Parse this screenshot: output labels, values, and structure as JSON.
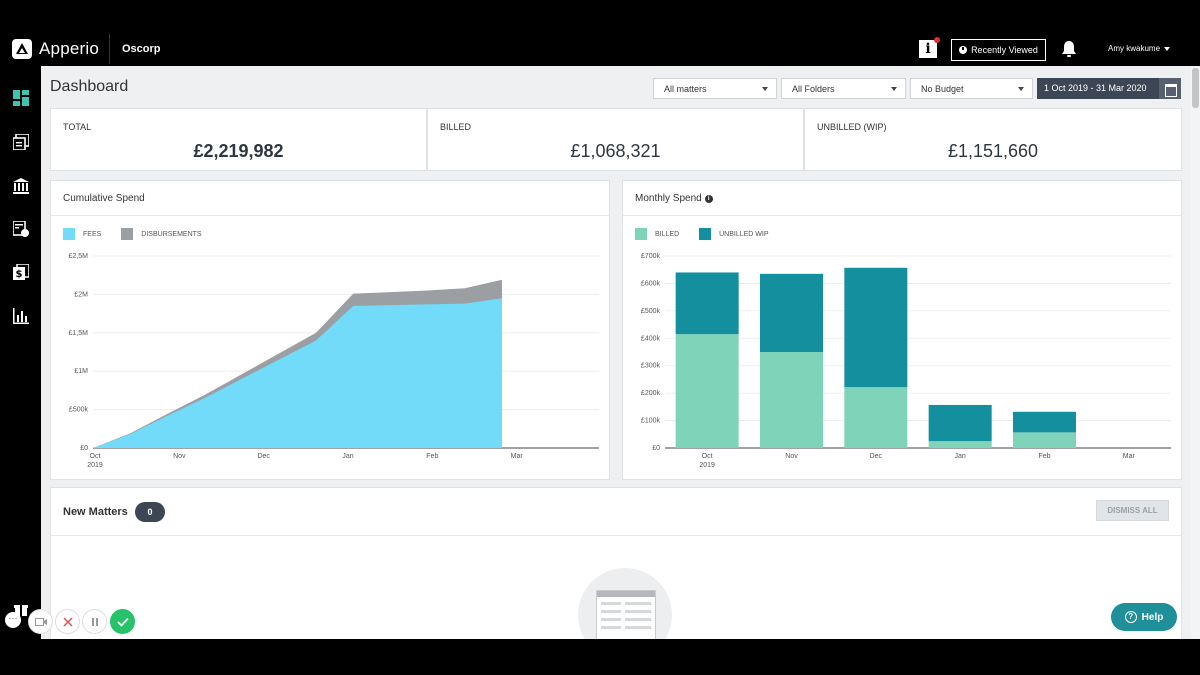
{
  "app": {
    "name": "Apperio",
    "client": "Oscorp",
    "recently_viewed": "Recently Viewed",
    "user": "Amy kwakume"
  },
  "sidebar": {
    "items": [
      "dashboard-icon",
      "documents-icon",
      "bank-icon",
      "budget-icon",
      "invoice-icon",
      "reports-icon"
    ]
  },
  "dashboard": {
    "title": "Dashboard",
    "filters": {
      "matters": "All matters",
      "folders": "All Folders",
      "budget": "No Budget",
      "date_range": "1 Oct 2019 - 31 Mar 2020"
    }
  },
  "stats": [
    {
      "label": "TOTAL",
      "value": "£2,219,982"
    },
    {
      "label": "BILLED",
      "value": "£1,068,321"
    },
    {
      "label": "UNBILLED (WIP)",
      "value": "£1,151,660"
    }
  ],
  "cumulative": {
    "title": "Cumulative Spend",
    "legend": [
      "FEES",
      "DISBURSEMENTS"
    ],
    "colors": {
      "fees": "#72dbf9",
      "disbursements": "#9b9ea2"
    }
  },
  "monthly": {
    "title": "Monthly Spend",
    "legend": [
      "BILLED",
      "UNBILLED WIP"
    ],
    "colors": {
      "billed": "#7ed3b8",
      "unbilled": "#148f9e"
    }
  },
  "chart_data": [
    {
      "type": "area",
      "title": "Cumulative Spend",
      "xlabel": "",
      "ylabel": "",
      "x_ticks": [
        "Oct\n2019",
        "Nov",
        "Dec",
        "Jan",
        "Feb",
        "Mar"
      ],
      "y_ticks": [
        "£0",
        "£500k",
        "£1M",
        "£1,5M",
        "£2M",
        "£2,5M"
      ],
      "ylim": [
        0,
        2500000
      ],
      "x": [
        "2019-10-01",
        "2019-10-15",
        "2019-11-01",
        "2019-11-15",
        "2019-12-01",
        "2019-12-15",
        "2020-01-01",
        "2020-01-15",
        "2020-02-01",
        "2020-02-15",
        "2020-03-01"
      ],
      "series": [
        {
          "name": "FEES",
          "values": [
            0,
            180000,
            420000,
            650000,
            900000,
            1150000,
            1400000,
            1850000,
            1860000,
            1870000,
            1880000,
            1950000
          ]
        },
        {
          "name": "DISBURSEMENTS",
          "values": [
            0,
            10000,
            25000,
            40000,
            60000,
            80000,
            100000,
            160000,
            170000,
            180000,
            200000,
            240000
          ]
        }
      ]
    },
    {
      "type": "bar",
      "title": "Monthly Spend",
      "categories": [
        "Oct\n2019",
        "Nov",
        "Dec",
        "Jan",
        "Feb",
        "Mar"
      ],
      "y_ticks": [
        "£0",
        "£100k",
        "£200k",
        "£300k",
        "£400k",
        "£500k",
        "£600k",
        "£700k"
      ],
      "ylim": [
        0,
        700000
      ],
      "stacked": true,
      "series": [
        {
          "name": "BILLED",
          "values": [
            415000,
            350000,
            222000,
            25000,
            57000,
            0
          ]
        },
        {
          "name": "UNBILLED WIP",
          "values": [
            225000,
            285000,
            435000,
            132000,
            75000,
            0
          ]
        }
      ]
    }
  ],
  "new_matters": {
    "title": "New Matters",
    "count": "0",
    "dismiss": "DISMISS ALL"
  },
  "help": {
    "label": "Help"
  }
}
